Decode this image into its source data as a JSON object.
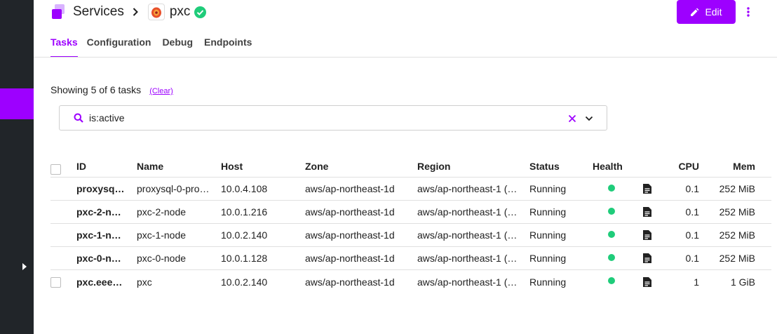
{
  "colors": {
    "accent": "#9d00ff",
    "rail": "#212529",
    "healthy": "#1fcc7a"
  },
  "breadcrumb": {
    "services_label": "Services",
    "service_name": "pxc"
  },
  "header": {
    "edit_label": "Edit"
  },
  "tabs": [
    {
      "label": "Tasks",
      "active": true
    },
    {
      "label": "Configuration"
    },
    {
      "label": "Debug"
    },
    {
      "label": "Endpoints"
    }
  ],
  "filter": {
    "showing_text": "Showing 5 of 6 tasks",
    "clear_label": "(Clear)",
    "query": "is:active"
  },
  "table": {
    "headers": {
      "id": "ID",
      "name": "Name",
      "host": "Host",
      "zone": "Zone",
      "region": "Region",
      "status": "Status",
      "health": "Health",
      "cpu": "CPU",
      "mem": "Mem"
    },
    "rows": [
      {
        "id": "proxysq…",
        "name": "proxysql-0-pro…",
        "host": "10.0.4.108",
        "zone": "aws/ap-northeast-1d",
        "region": "aws/ap-northeast-1 (…",
        "status": "Running",
        "health": "healthy",
        "cpu": "0.1",
        "mem": "252 MiB",
        "checkbox": false
      },
      {
        "id": "pxc-2-n…",
        "name": "pxc-2-node",
        "host": "10.0.1.216",
        "zone": "aws/ap-northeast-1d",
        "region": "aws/ap-northeast-1 (…",
        "status": "Running",
        "health": "healthy",
        "cpu": "0.1",
        "mem": "252 MiB",
        "checkbox": false
      },
      {
        "id": "pxc-1-n…",
        "name": "pxc-1-node",
        "host": "10.0.2.140",
        "zone": "aws/ap-northeast-1d",
        "region": "aws/ap-northeast-1 (…",
        "status": "Running",
        "health": "healthy",
        "cpu": "0.1",
        "mem": "252 MiB",
        "checkbox": false
      },
      {
        "id": "pxc-0-n…",
        "name": "pxc-0-node",
        "host": "10.0.1.128",
        "zone": "aws/ap-northeast-1d",
        "region": "aws/ap-northeast-1 (…",
        "status": "Running",
        "health": "healthy",
        "cpu": "0.1",
        "mem": "252 MiB",
        "checkbox": false
      },
      {
        "id": "pxc.eee…",
        "name": "pxc",
        "host": "10.0.2.140",
        "zone": "aws/ap-northeast-1d",
        "region": "aws/ap-northeast-1 (…",
        "status": "Running",
        "health": "healthy",
        "cpu": "1",
        "mem": "1 GiB",
        "checkbox": true
      }
    ]
  }
}
